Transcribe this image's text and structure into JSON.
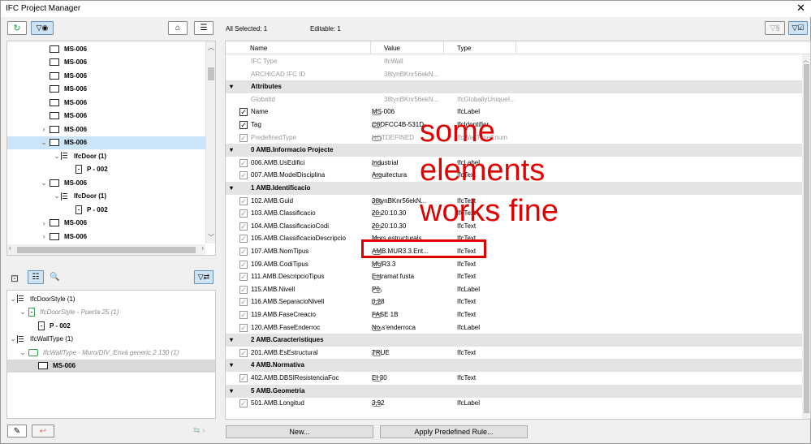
{
  "window": {
    "title": "IFC Project Manager",
    "close": "✕"
  },
  "left_tree": {
    "rows": [
      {
        "label": "MS-006",
        "chev": "",
        "icon": "element",
        "indent": 0
      },
      {
        "label": "MS-006",
        "chev": "",
        "icon": "element",
        "indent": 0
      },
      {
        "label": "MS-006",
        "chev": "",
        "icon": "element",
        "indent": 0
      },
      {
        "label": "MS-006",
        "chev": "",
        "icon": "element",
        "indent": 0
      },
      {
        "label": "MS-006",
        "chev": "",
        "icon": "element",
        "indent": 0
      },
      {
        "label": "MS-006",
        "chev": "",
        "icon": "element",
        "indent": 0
      },
      {
        "label": "MS-006",
        "chev": "›",
        "icon": "element",
        "indent": 0
      },
      {
        "label": "MS-006",
        "chev": "⌄",
        "icon": "element",
        "indent": 0,
        "selected": true
      },
      {
        "label": "IfcDoor (1)",
        "chev": "⌄",
        "icon": "type",
        "indent": 1
      },
      {
        "label": "P - 002",
        "chev": "",
        "icon": "door",
        "indent": 2
      },
      {
        "label": "MS-006",
        "chev": "⌄",
        "icon": "element",
        "indent": 0
      },
      {
        "label": "IfcDoor (1)",
        "chev": "⌄",
        "icon": "type",
        "indent": 1
      },
      {
        "label": "P - 002",
        "chev": "",
        "icon": "door",
        "indent": 2
      },
      {
        "label": "MS-006",
        "chev": "›",
        "icon": "element",
        "indent": 0
      },
      {
        "label": "MS-006",
        "chev": "›",
        "icon": "element",
        "indent": 0
      }
    ]
  },
  "type_tree": {
    "rows": [
      {
        "label": "IfcDoorStyle (1)",
        "chev": "⌄",
        "icon": "type",
        "indent": 0,
        "style": "normal"
      },
      {
        "label": "IfcDoorStyle - Puerta 25 (1)",
        "chev": "⌄",
        "icon": "doorstyle",
        "indent": 1,
        "style": "italic"
      },
      {
        "label": "P - 002",
        "chev": "",
        "icon": "door",
        "indent": 2,
        "style": "bold"
      },
      {
        "label": "IfcWallType (1)",
        "chev": "⌄",
        "icon": "type",
        "indent": 0,
        "style": "normal"
      },
      {
        "label": "IfcWallType - Muro/DIV_Envà generic 2 130 (1)",
        "chev": "⌄",
        "icon": "walltype",
        "indent": 1,
        "style": "italic"
      },
      {
        "label": "MS-006",
        "chev": "",
        "icon": "element",
        "indent": 2,
        "style": "bold",
        "selected": true
      }
    ]
  },
  "header": {
    "all_selected": "All Selected: 1",
    "editable": "Editable: 1"
  },
  "columns": {
    "name": "Name",
    "value": "Value",
    "type": "Type"
  },
  "rows": [
    {
      "kind": "plain",
      "name": "IFC Type",
      "value": "IfcWall",
      "type": "",
      "gray": true
    },
    {
      "kind": "plain",
      "name": "ARCHICAD IFC ID",
      "value": "38tynBKnr56ekN...",
      "type": "",
      "gray": true
    },
    {
      "kind": "group",
      "name": "Attributes"
    },
    {
      "kind": "plain",
      "name": "GlobalId",
      "value": "38tynBKnr56ekN...",
      "type": "IfcGloballyUniqueI...",
      "gray": true
    },
    {
      "kind": "prop",
      "check": "on",
      "name": "Name",
      "value": "MS-006",
      "type": "IfcLabel",
      "link": true
    },
    {
      "kind": "prop",
      "check": "on",
      "name": "Tag",
      "value": "C8DFCC4B-531D-...",
      "type": "IfcIdentifier",
      "link": true
    },
    {
      "kind": "prop",
      "check": "dis",
      "name": "PredefinedType",
      "value": "NOTDEFINED",
      "type": "IfcWallTypeEnum",
      "link": true,
      "gray": true
    },
    {
      "kind": "group",
      "name": "0 AMB.Informacio Projecte"
    },
    {
      "kind": "prop",
      "check": "dis",
      "name": "006.AMB.UsEdifici",
      "value": "Industrial",
      "type": "IfcLabel",
      "link": true
    },
    {
      "kind": "prop",
      "check": "dis",
      "name": "007.AMB.ModelDisciplina",
      "value": "Arquitectura",
      "type": "IfcText",
      "link": true
    },
    {
      "kind": "group",
      "name": "1 AMB.Identificacio"
    },
    {
      "kind": "prop",
      "check": "dis",
      "name": "102.AMB.Guid",
      "value": "38tynBKnr56ekN...",
      "type": "IfcText",
      "link": true
    },
    {
      "kind": "prop",
      "check": "dis",
      "name": "103.AMB.Classificacio",
      "value": "20.20.10.30",
      "type": "IfcText",
      "link": true
    },
    {
      "kind": "prop",
      "check": "dis",
      "name": "104.AMB.ClassificacioCodi",
      "value": "20.20.10.30",
      "type": "IfcText",
      "link": true
    },
    {
      "kind": "prop",
      "check": "dis",
      "name": "105.AMB.ClassificacioDescripcio",
      "value": "Murs estructurals",
      "type": "IfcText",
      "link": true
    },
    {
      "kind": "prop",
      "check": "dis",
      "name": "107.AMB.NomTipus",
      "value": "AMB.MUR3.3.Ent...",
      "type": "IfcText",
      "link": true
    },
    {
      "kind": "prop",
      "check": "dis",
      "name": "109.AMB.CodiTipus",
      "value": "MUR3.3",
      "type": "IfcText",
      "link": true
    },
    {
      "kind": "prop",
      "check": "dis",
      "name": "111.AMB.DescripcioTipus",
      "value": "Entramat fusta",
      "type": "IfcText",
      "link": true
    },
    {
      "kind": "prop",
      "check": "dis",
      "name": "115.AMB.Nivell",
      "value": "P0",
      "type": "IfcLabel",
      "link": true
    },
    {
      "kind": "prop",
      "check": "dis",
      "name": "116.AMB.SeparacioNivell",
      "value": "0,28",
      "type": "IfcText",
      "link": true
    },
    {
      "kind": "prop",
      "check": "dis",
      "name": "119.AMB.FaseCreacio",
      "value": "FASE 1B",
      "type": "IfcText",
      "link": true
    },
    {
      "kind": "prop",
      "check": "dis",
      "name": "120.AMB.FaseEnderroc",
      "value": "No s'enderroca",
      "type": "IfcLabel",
      "link": true
    },
    {
      "kind": "group",
      "name": "2 AMB.Caracteristiques"
    },
    {
      "kind": "prop",
      "check": "dis",
      "name": "201.AMB.EsEstructural",
      "value": "TRUE",
      "type": "IfcText",
      "link": true
    },
    {
      "kind": "group",
      "name": "4 AMB.Normativa"
    },
    {
      "kind": "prop",
      "check": "dis",
      "name": "402.AMB.DBSIResistenciaFoc",
      "value": "EI 30",
      "type": "IfcText",
      "link": true
    },
    {
      "kind": "group",
      "name": "5 AMB.Geometria"
    },
    {
      "kind": "prop",
      "check": "dis",
      "name": "501.AMB.Longitud",
      "value": "3,92",
      "type": "IfcLabel",
      "link": true
    }
  ],
  "annotation": {
    "lines": [
      "some",
      "elements",
      "works fine"
    ],
    "color": "#e00000"
  },
  "buttons": {
    "new": "New...",
    "apply": "Apply Predefined Rule..."
  },
  "icons": {
    "refresh": "↻",
    "eye": "👁",
    "search": "🔍",
    "pencil": "✎",
    "hide": "↩",
    "checkmark": "✓",
    "filter_tree": "T",
    "sort": "⇅"
  }
}
